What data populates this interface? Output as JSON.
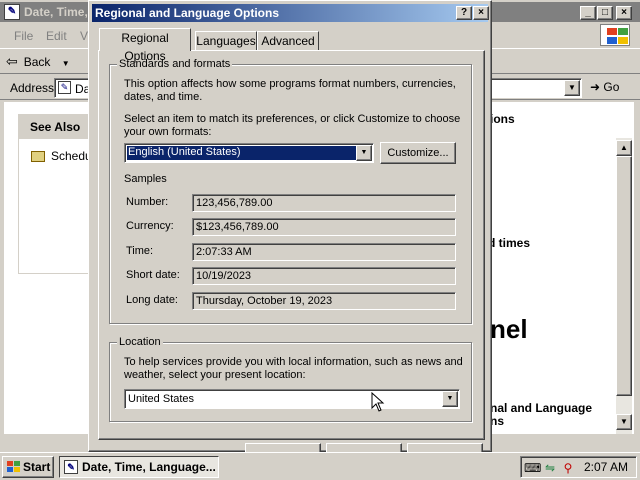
{
  "background_window": {
    "title": "Date, Time, Language, and Regional Options",
    "menu": [
      "File",
      "Edit",
      "V"
    ],
    "toolbar": {
      "back_label": "Back"
    },
    "address": {
      "label": "Address",
      "value": "Da"
    },
    "go_label": "Go",
    "see_also": {
      "heading": "See Also",
      "link": "Schedu"
    },
    "visible_fragments": [
      "ions",
      "d times",
      "nel",
      "nal and Language",
      "ns"
    ]
  },
  "dialog": {
    "title": "Regional and Language Options",
    "tabs": [
      "Regional Options",
      "Languages",
      "Advanced"
    ],
    "active_tab": "Regional Options",
    "standards": {
      "legend": "Standards and formats",
      "desc": "This option affects how some programs format numbers, currencies, dates, and time.",
      "select_prompt": "Select an item to match its preferences, or click Customize to choose your own formats:",
      "selected_format": "English (United States)",
      "customize_label": "Customize...",
      "samples_heading": "Samples",
      "samples": [
        {
          "label": "Number:",
          "value": "123,456,789.00"
        },
        {
          "label": "Currency:",
          "value": "$123,456,789.00"
        },
        {
          "label": "Time:",
          "value": "2:07:33 AM"
        },
        {
          "label": "Short date:",
          "value": "10/19/2023"
        },
        {
          "label": "Long date:",
          "value": "Thursday, October 19, 2023"
        }
      ]
    },
    "location": {
      "legend": "Location",
      "desc": "To help services provide you with local information, such as news and weather, select your present location:",
      "selected": "United States"
    }
  },
  "taskbar": {
    "start_label": "Start",
    "task_label": "Date, Time, Language...",
    "clock": "2:07 AM"
  },
  "colors": {
    "title_active_start": "#0a246a",
    "title_active_end": "#a6caf0",
    "title_inactive": "#808080",
    "face": "#d4d0c8",
    "selection": "#0a246a"
  }
}
